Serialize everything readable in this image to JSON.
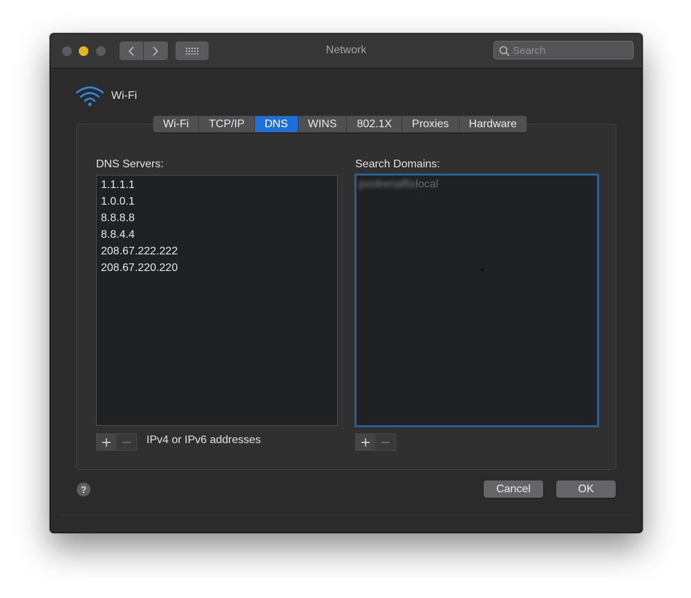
{
  "window": {
    "title": "Network"
  },
  "search": {
    "placeholder": "Search"
  },
  "interface": {
    "name": "Wi-Fi"
  },
  "tabs": [
    {
      "label": "Wi-Fi"
    },
    {
      "label": "TCP/IP"
    },
    {
      "label": "DNS"
    },
    {
      "label": "WINS"
    },
    {
      "label": "802.1X"
    },
    {
      "label": "Proxies"
    },
    {
      "label": "Hardware"
    }
  ],
  "dns": {
    "label": "DNS Servers:",
    "servers": [
      "1.1.1.1",
      "1.0.0.1",
      "8.8.8.8",
      "8.8.4.4",
      "208.67.222.222",
      "208.67.220.220"
    ],
    "hint": "IPv4 or IPv6 addresses"
  },
  "domains": {
    "label": "Search Domains:",
    "items": [
      {
        "blurred_part": "poolrenaffix",
        "visible_part": "local"
      }
    ]
  },
  "buttons": {
    "help": "?",
    "cancel": "Cancel",
    "ok": "OK"
  },
  "colors": {
    "accent": "#1f6fdb",
    "focus_ring": "#2a5f92",
    "minimize": "#e2b626"
  }
}
